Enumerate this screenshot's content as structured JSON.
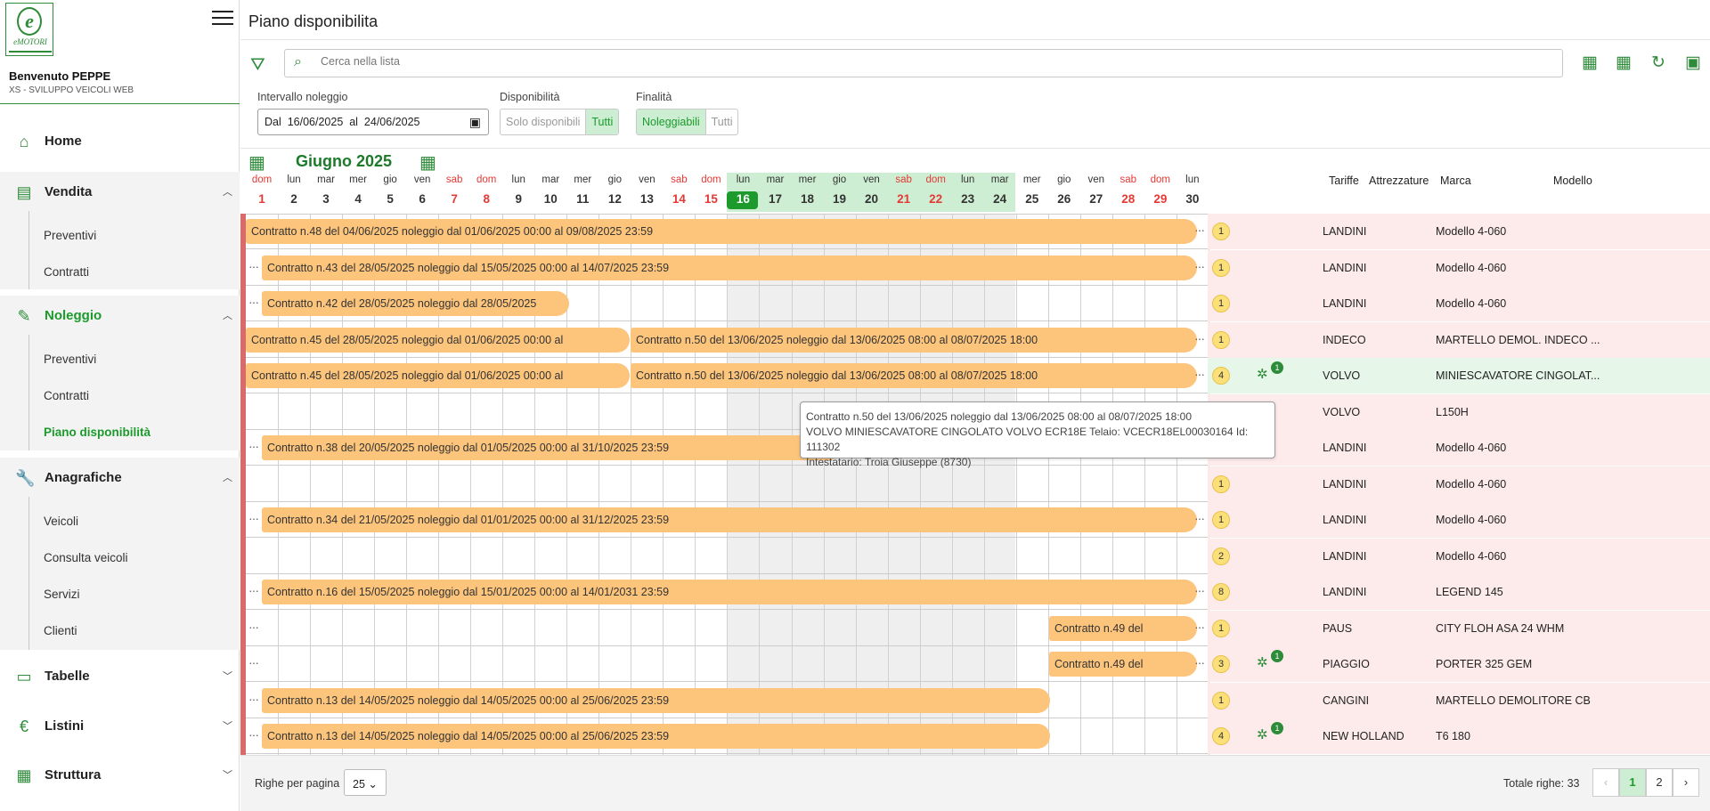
{
  "sidebar": {
    "welcome": "Benvenuto PEPPE",
    "company": "XS - SVILUPPO VEICOLI WEB",
    "logo_text": "eMOTORI",
    "nav": {
      "home": "Home",
      "vendita": "Vendita",
      "vendita_items": [
        "Preventivi",
        "Contratti"
      ],
      "noleggio": "Noleggio",
      "noleggio_items": [
        "Preventivi",
        "Contratti",
        "Piano disponibilità"
      ],
      "anagrafiche": "Anagrafiche",
      "anagrafiche_items": [
        "Veicoli",
        "Consulta veicoli",
        "Servizi",
        "Clienti"
      ],
      "tabelle": "Tabelle",
      "listini": "Listini",
      "struttura": "Struttura"
    }
  },
  "header": {
    "title": "Piano disponibilita"
  },
  "search": {
    "placeholder": "Cerca nella lista"
  },
  "filters": {
    "intervallo_label": "Intervallo noleggio",
    "dal": "Dal",
    "dal_value": "16/06/2025",
    "al": "al",
    "al_value": "24/06/2025",
    "disponibilita_label": "Disponibilità",
    "disp_options": [
      "Solo disponibili",
      "Tutti"
    ],
    "finalita_label": "Finalità",
    "fin_options": [
      "Noleggiabili",
      "Tutti"
    ]
  },
  "calendar": {
    "month": "Giugno 2025",
    "day_names": [
      "dom",
      "lun",
      "mar",
      "mer",
      "gio",
      "ven",
      "sab",
      "dom",
      "lun",
      "mar",
      "mer",
      "gio",
      "ven",
      "sab",
      "dom",
      "lun",
      "mar",
      "mer",
      "gio",
      "ven",
      "sab",
      "dom",
      "lun",
      "mar",
      "mer",
      "gio",
      "ven",
      "sab",
      "dom",
      "lun"
    ],
    "day_numbers": [
      "1",
      "2",
      "3",
      "4",
      "5",
      "6",
      "7",
      "8",
      "9",
      "10",
      "11",
      "12",
      "13",
      "14",
      "15",
      "16",
      "17",
      "18",
      "19",
      "20",
      "21",
      "22",
      "23",
      "24",
      "25",
      "26",
      "27",
      "28",
      "29",
      "30"
    ],
    "columns": {
      "tariffe": "Tariffe",
      "attrezzature": "Attrezzature",
      "marca": "Marca",
      "modello": "Modello"
    }
  },
  "rows": [
    {
      "bars": [
        "Contratto n.48  del 04/06/2025 noleggio dal 01/06/2025 00:00 al 09/08/2025 23:59"
      ],
      "badge": "1",
      "marca": "LANDINI",
      "modello": "Modello 4-060"
    },
    {
      "bars": [
        "Contratto n.43  del 28/05/2025 noleggio dal 15/05/2025 00:00 al 14/07/2025 23:59"
      ],
      "badge": "1",
      "marca": "LANDINI",
      "modello": "Modello 4-060"
    },
    {
      "bars": [
        "Contratto n.42  del 28/05/2025 noleggio dal 28/05/2025"
      ],
      "badge": "1",
      "marca": "LANDINI",
      "modello": "Modello 4-060"
    },
    {
      "bars": [
        "Contratto n.45  del 28/05/2025 noleggio dal 01/06/2025 00:00 al",
        "Contratto n.50  del 13/06/2025 noleggio dal 13/06/2025 08:00 al 08/07/2025 18:00"
      ],
      "badge": "1",
      "marca": "INDECO",
      "modello": "MARTELLO DEMOL. INDECO ..."
    },
    {
      "bars": [
        "Contratto n.45  del 28/05/2025 noleggio dal 01/06/2025 00:00 al",
        "Contratto n.50  del 13/06/2025 noleggio dal 13/06/2025 08:00 al 08/07/2025 18:00"
      ],
      "badge": "4",
      "plug": "1",
      "marca": "VOLVO",
      "modello": "MINIESCAVATORE CINGOLAT..."
    },
    {
      "bars": [],
      "badge": "",
      "marca": "VOLVO",
      "modello": "L150H"
    },
    {
      "bars": [
        "Contratto n.38  del 20/05/2025 noleggio dal 01/05/2025 00:00 al 31/10/2025 23:59"
      ],
      "badge": "",
      "marca": "LANDINI",
      "modello": "Modello 4-060"
    },
    {
      "bars": [],
      "badge": "1",
      "marca": "LANDINI",
      "modello": "Modello 4-060"
    },
    {
      "bars": [
        "Contratto n.34  del 21/05/2025 noleggio dal 01/01/2025 00:00 al 31/12/2025 23:59"
      ],
      "badge": "1",
      "marca": "LANDINI",
      "modello": "Modello 4-060"
    },
    {
      "bars": [],
      "badge": "2",
      "marca": "LANDINI",
      "modello": "Modello 4-060"
    },
    {
      "bars": [
        "Contratto n.16  del 15/05/2025 noleggio dal 15/01/2025 00:00 al 14/01/2031 23:59"
      ],
      "badge": "8",
      "marca": "LANDINI",
      "modello": "LEGEND 145"
    },
    {
      "bars": [
        "Contratto n.49  del"
      ],
      "badge": "1",
      "marca": "PAUS",
      "modello": "CITY FLOH ASA 24 WHM"
    },
    {
      "bars": [
        "Contratto n.49  del"
      ],
      "badge": "3",
      "plug": "1",
      "marca": "PIAGGIO",
      "modello": "PORTER 325 GEM"
    },
    {
      "bars": [
        "Contratto n.13  del 14/05/2025 noleggio dal 14/05/2025 00:00 al 25/06/2025 23:59"
      ],
      "badge": "1",
      "marca": "CANGINI",
      "modello": "MARTELLO DEMOLITORE CB"
    },
    {
      "bars": [
        "Contratto n.13  del 14/05/2025 noleggio dal 14/05/2025 00:00 al 25/06/2025 23:59"
      ],
      "badge": "4",
      "plug": "1",
      "marca": "NEW HOLLAND",
      "modello": "T6 180"
    }
  ],
  "tooltip": {
    "line1": "Contratto n.50  del 13/06/2025 noleggio dal 13/06/2025 08:00 al 08/07/2025 18:00",
    "line2": "VOLVO MINIESCAVATORE CINGOLATO VOLVO ECR18E Telaio: VCECR18EL00030164 Id: 111302",
    "line3": "Intestatario: Troia Giuseppe (8730)"
  },
  "footer": {
    "rows_per_page_label": "Righe per pagina",
    "rows_per_page": "25",
    "total": "Totale righe: 33",
    "pages": [
      "1",
      "2"
    ]
  }
}
